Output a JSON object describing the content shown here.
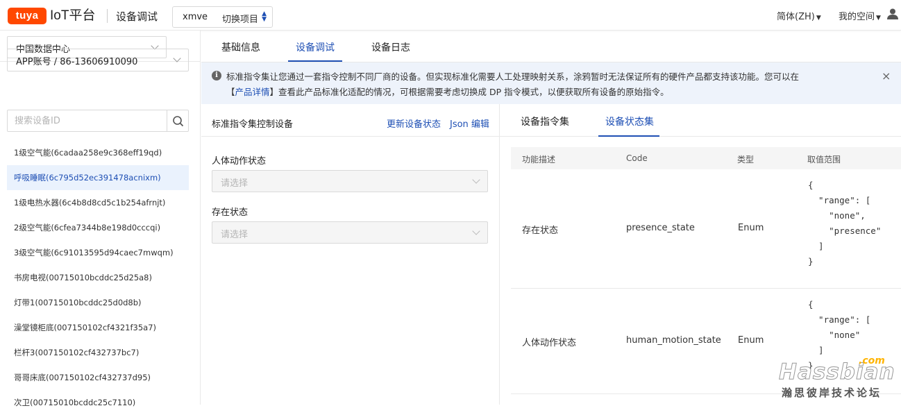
{
  "header": {
    "logo": "tuya",
    "platform": "IoT平台",
    "page_title": "设备调试",
    "project_name": "xmve",
    "project_switch": "切换项目",
    "language": "简体(ZH)",
    "my_space": "我的空间",
    "user_icon": "user-icon"
  },
  "sidebar": {
    "datacenter": "中国数据中心",
    "account": "APP账号 / 86-13606910090",
    "search_placeholder": "搜索设备ID",
    "devices": [
      "1级空气能(6cadaa258e9c368eff19qd)",
      "呼吸睡眠(6c795d52ec391478acnixm)",
      "1级电热水器(6c4b8d8cd5c1b254afrnjt)",
      "2级空气能(6cfea7344b8e198d0cccqi)",
      "3级空气能(6c91013595d94caec7mwqm)",
      "书房电视(00715010bcddc25d25a8)",
      "灯带1(00715010bcddc25d0d8b)",
      "澡堂镜柜底(007150102cf4321f35a7)",
      "栏杆3(007150102cf432737bc7)",
      "哥哥床底(007150102cf432737d95)",
      "次卫(00715010bcddc25c7110)"
    ],
    "active_index": 1
  },
  "tabs": [
    "基础信息",
    "设备调试",
    "设备日志"
  ],
  "active_tab": 1,
  "alert": {
    "line1": "标准指令集让您通过一套指令控制不同厂商的设备。但实现标准化需要人工处理映射关系，涂鸦暂时无法保证所有的硬件产品都支持该功能。您可以在",
    "bracket_open": "【",
    "link": "产品详情",
    "bracket_close": "】",
    "line2": "查看此产品标准化适配的情况，可根据需要考虑切换成 DP 指令模式，以便获取所有设备的原始指令。",
    "close": "×"
  },
  "left_panel": {
    "title": "标准指令集控制设备",
    "refresh": "更新设备状态",
    "json_edit": "Json 编辑",
    "fields": [
      {
        "label": "人体动作状态",
        "placeholder": "请选择"
      },
      {
        "label": "存在状态",
        "placeholder": "请选择"
      }
    ]
  },
  "right_panel": {
    "tabs": [
      "设备指令集",
      "设备状态集"
    ],
    "active_tab": 1,
    "columns": [
      "功能描述",
      "Code",
      "类型",
      "取值范围"
    ],
    "rows": [
      {
        "desc": "存在状态",
        "code": "presence_state",
        "type": "Enum",
        "range": "{\n  \"range\": [\n    \"none\",\n    \"presence\"\n  ]\n}"
      },
      {
        "desc": "人体动作状态",
        "code": "human_motion_state",
        "type": "Enum",
        "range": "{\n  \"range\": [\n    \"none\"\n  ]\n}"
      }
    ]
  },
  "watermark": {
    "main": "Hassbian",
    "com": ".com",
    "sub": "瀚思彼岸技术论坛"
  }
}
